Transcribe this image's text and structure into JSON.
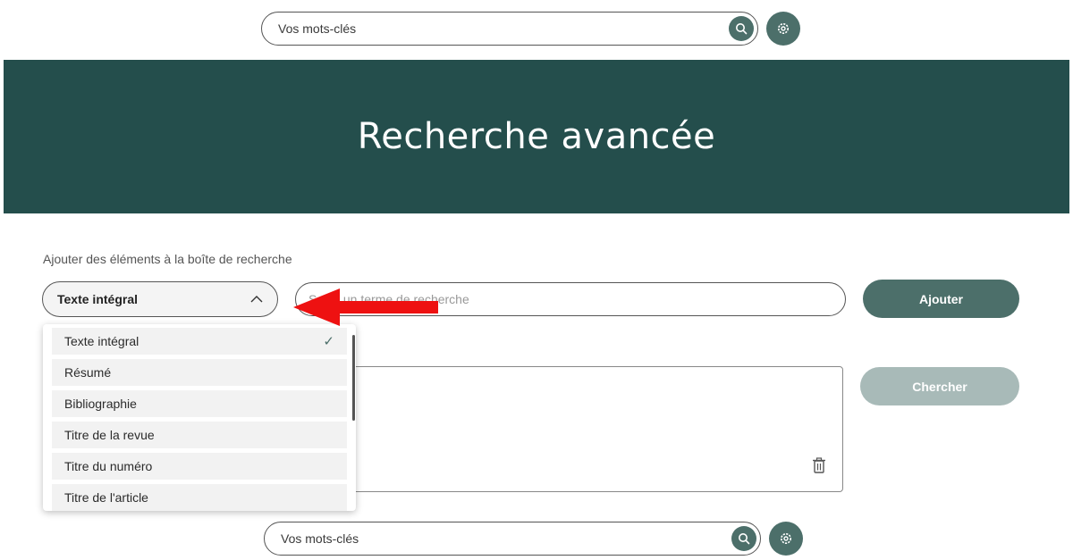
{
  "top_search": {
    "placeholder": "Vos mots-clés"
  },
  "hero": {
    "title": "Recherche avancée"
  },
  "form": {
    "section_label": "Ajouter des éléments à la boîte de recherche",
    "field_select_value": "Texte intégral",
    "term_placeholder": "Saisir un terme de recherche",
    "add_button": "Ajouter",
    "search_button": "Chercher"
  },
  "dropdown": {
    "items": [
      {
        "label": "Texte intégral",
        "selected": true
      },
      {
        "label": "Résumé",
        "selected": false
      },
      {
        "label": "Bibliographie",
        "selected": false
      },
      {
        "label": "Titre de la revue",
        "selected": false
      },
      {
        "label": "Titre du numéro",
        "selected": false
      },
      {
        "label": "Titre de l'article",
        "selected": false
      }
    ],
    "check_glyph": "✓"
  },
  "bottom_search": {
    "placeholder": "Vos mots-clés"
  },
  "colors": {
    "hero_bg": "#244e4c",
    "accent": "#4c6f6a",
    "disabled": "#a8bab8",
    "annotation_arrow": "#ee1111"
  },
  "icons": [
    "search-icon",
    "gear-icon",
    "chevron-up-icon",
    "check-icon",
    "trash-icon",
    "annotation-arrow"
  ]
}
